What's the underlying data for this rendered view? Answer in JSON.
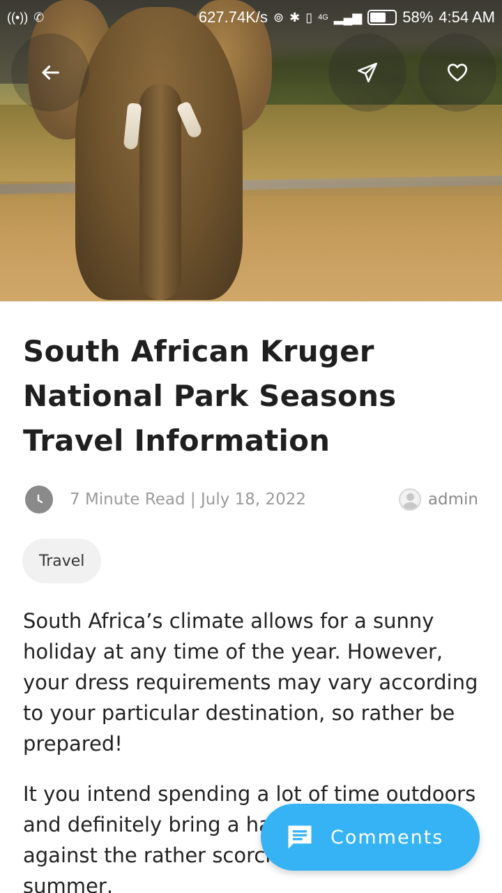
{
  "status_bar": {
    "speed": "627.74K/s",
    "network": "4G",
    "battery": "58%",
    "time": "4:54 AM"
  },
  "hero": {
    "image_alt": "elephant"
  },
  "actions": {
    "back_icon": "arrow-left-icon",
    "share_icon": "send-icon",
    "favorite_icon": "heart-icon"
  },
  "article": {
    "title": "South African Kruger National Park Seasons Travel Information",
    "read_time_date": "7 Minute Read | July 18, 2022",
    "author": "admin",
    "tag": "Travel",
    "paragraphs": [
      "South Africa’s climate allows for a sunny holiday at any time of the year. However, your dress requirements may vary according to your particular destination, so rather be prepared!",
      "It you intend spending a lot of time outdoors and definitely bring a hat for protection against the rather scorching sun. In the summer,"
    ]
  },
  "comments_button": {
    "label": "Comments",
    "color": "#35b3f5"
  }
}
